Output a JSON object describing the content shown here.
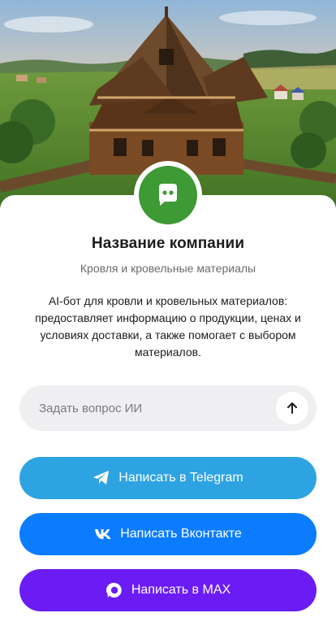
{
  "company": {
    "name": "Название компании",
    "subtitle": "Кровля и кровельные материалы",
    "description": "AI-бот для кровли и кровельных материалов: предоставляет информацию о продукции, ценах и условиях доставки, а также помогает с выбором материалов.",
    "avatar_icon": "chat-bot-icon",
    "avatar_color": "#3d9a34"
  },
  "ask": {
    "placeholder": "Задать вопрос ИИ",
    "value": "",
    "send_icon": "arrow-up-icon"
  },
  "actions": [
    {
      "label": "Написать в Telegram",
      "icon": "telegram-icon",
      "color": "#2ea3e2"
    },
    {
      "label": "Написать Вконтакте",
      "icon": "vk-icon",
      "color": "#0c7cff"
    },
    {
      "label": "Написать в MAX",
      "icon": "max-icon",
      "color": "#6b1cf5"
    }
  ]
}
